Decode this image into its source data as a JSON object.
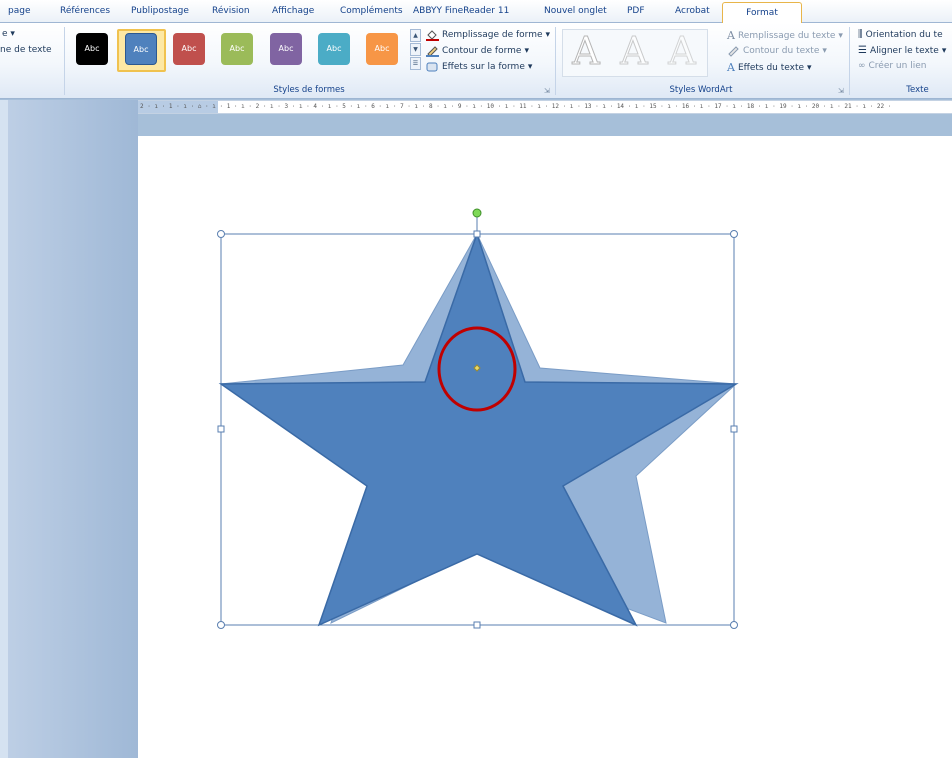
{
  "tabs": [
    "page",
    "Références",
    "Publipostage",
    "Révision",
    "Affichage",
    "Compléments",
    "ABBYY FineReader 11",
    "Nouvel onglet",
    "PDF",
    "Acrobat"
  ],
  "active_tab": "Format",
  "left_partial": {
    "line1": "e ▾",
    "line2": "ne de texte"
  },
  "shape_styles": {
    "label": "Styles de formes",
    "swatch_label": "Abc",
    "swatches": [
      {
        "color": "#000000"
      },
      {
        "color": "#4f81bd"
      },
      {
        "color": "#c0504d"
      },
      {
        "color": "#9bbb59"
      },
      {
        "color": "#8064a2"
      },
      {
        "color": "#4bacc6"
      },
      {
        "color": "#f79646"
      }
    ],
    "commands": {
      "fill": "Remplissage de forme",
      "outline": "Contour de forme",
      "effects": "Effets sur la forme"
    }
  },
  "wordart": {
    "label": "Styles WordArt",
    "letter": "A",
    "commands": {
      "text_fill": "Remplissage du texte",
      "text_outline": "Contour du texte",
      "text_effects": "Effets du texte"
    }
  },
  "text_group": {
    "label": "Texte",
    "commands": {
      "orientation": "Orientation du te",
      "align": "Aligner le texte",
      "link": "Créer un lien"
    }
  },
  "ruler_text": "2 · ı · 1 · ı · ⌂ · ı · 1 · ı · 2 · ı · 3 · ı · 4 · ı · 5 · ı · 6 · ı · 7 · ı · 8 · ı · 9 · ı · 10 · ı · 11 · ı · 12 · ı · 13 · ı · 14 · ı · 15 · ı · 16 · ı · 17 · ı · 18 · ı · 19 · ı · 20 · ı · 21 · ı · 22 ·",
  "colors": {
    "accent_tab_border": "#e8b54a",
    "star_fill": "#4f81bd",
    "star_shadow": "#95b3d7",
    "annotation_circle": "#c00000",
    "rotate_handle": "#7ed957"
  }
}
